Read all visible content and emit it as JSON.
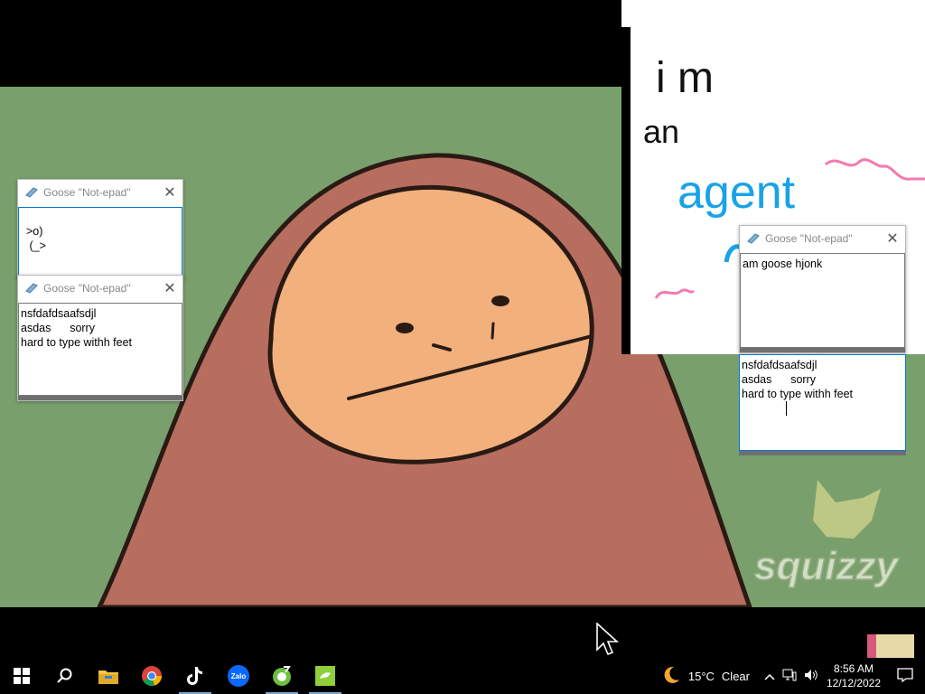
{
  "wallpaper": {
    "watermark": "squizzy",
    "colors": {
      "bg": "#79a06c",
      "body": "#b76e5e",
      "face": "#f2b07c",
      "outline": "#2a1a14"
    }
  },
  "drawing_canvas": {
    "text_lines": [
      "i  m",
      "an",
      "agent"
    ],
    "colors": {
      "ink": "#111111",
      "blue": "#1aa2e6",
      "pink": "#f27bb0"
    }
  },
  "windows": [
    {
      "id": "left-top",
      "title": "Goose \"Not-epad\"",
      "close_icon": "close-icon",
      "body": ">o)\n (_>",
      "active": true
    },
    {
      "id": "left-bottom",
      "title": "Goose \"Not-epad\"",
      "close_icon": "close-icon",
      "body": "nsfdafdsaafsdjl\nasdas      sorry\nhard to type withh feet",
      "active": false
    },
    {
      "id": "right-top",
      "title": "Goose \"Not-epad\"",
      "close_icon": "close-icon",
      "body": "am goose hjonk",
      "active": false
    },
    {
      "id": "right-bottom",
      "title": "Goose \"Not-epad\"",
      "close_icon": "close-icon",
      "body": "nsfdafdsaafsdjl\nasdas      sorry\nhard to type withh feet",
      "active": true
    }
  ],
  "taskbar": {
    "start_icon": "windows-start-icon",
    "search_icon": "search-icon",
    "apps": [
      {
        "name": "file-explorer-icon",
        "running": false
      },
      {
        "name": "chrome-icon",
        "running": false
      },
      {
        "name": "tiktok-icon",
        "running": false
      },
      {
        "name": "zalo-icon",
        "running": false,
        "label": "Zalo"
      },
      {
        "name": "green-app-icon",
        "running": false
      },
      {
        "name": "goose-app-icon",
        "running": false
      }
    ],
    "weather": {
      "icon": "moon-icon",
      "temp": "15°C",
      "condition": "Clear"
    },
    "tray_icons": [
      "chevron-up-icon",
      "network-icon",
      "volume-icon"
    ],
    "clock": {
      "time": "8:56 AM",
      "date": "12/12/2022"
    },
    "notification_icon": "notification-icon"
  }
}
